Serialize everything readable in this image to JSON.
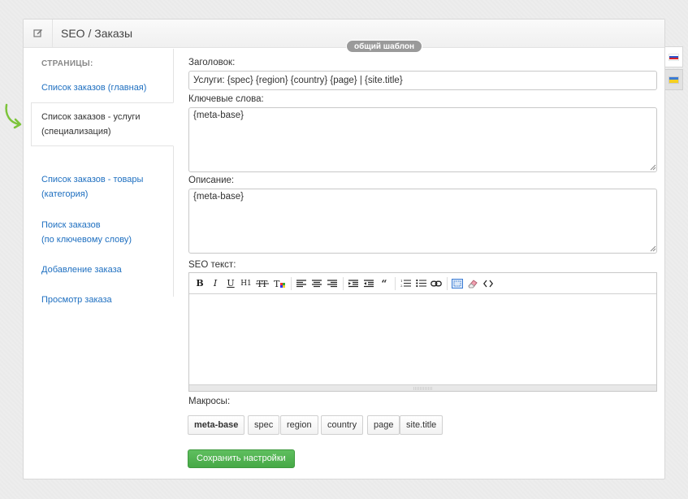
{
  "header": {
    "title": "SEO / Заказы",
    "edit_icon": "edit-icon",
    "template_badge": "общий шаблон"
  },
  "sidebar": {
    "heading": "СТРАНИЦЫ:",
    "items": [
      {
        "label": "Список заказов (главная)",
        "active": false
      },
      {
        "label_line1": "Список заказов - услуги",
        "label_line2": "(специализация)",
        "active": true
      },
      {
        "label_line1": "Список заказов - товары",
        "label_line2": "(категория)",
        "active": false
      },
      {
        "label_line1": "Поиск заказов",
        "label_line2": "(по ключевому слову)",
        "active": false
      },
      {
        "label": "Добавление заказа",
        "active": false
      },
      {
        "label": "Просмотр заказа",
        "active": false
      }
    ],
    "pointer_icon": "curved-arrow-icon",
    "pointer_color": "#7cc43a"
  },
  "form": {
    "title_label": "Заголовок:",
    "title_value": "Услуги: {spec} {region} {country} {page} | {site.title}",
    "keywords_label": "Ключевые слова:",
    "keywords_value": "{meta-base}",
    "description_label": "Описание:",
    "description_value": "{meta-base}",
    "seo_text_label": "SEO текст:",
    "seo_text_value": "",
    "macros_label": "Макросы:",
    "macros": [
      "meta-base",
      "spec",
      "region",
      "country",
      "page",
      "site.title"
    ],
    "save_label": "Сохранить настройки"
  },
  "editor_toolbar": {
    "bold": "B",
    "italic": "I",
    "underline": "U",
    "heading": "H1",
    "icons": [
      "strikethrough-icon",
      "text-color-icon",
      "align-left-icon",
      "align-center-icon",
      "align-right-icon",
      "indent-icon",
      "outdent-icon",
      "quote-icon",
      "ordered-list-icon",
      "unordered-list-icon",
      "link-icon",
      "fullscreen-icon",
      "eraser-icon",
      "source-code-icon"
    ]
  },
  "languages": [
    {
      "code": "ru",
      "icon": "russia-flag-icon",
      "active": true
    },
    {
      "code": "uk",
      "icon": "ukraine-flag-icon",
      "active": false
    }
  ],
  "colors": {
    "link": "#1e6fc0",
    "save_button": "#4fb34f",
    "badge": "#9a9a9a"
  }
}
